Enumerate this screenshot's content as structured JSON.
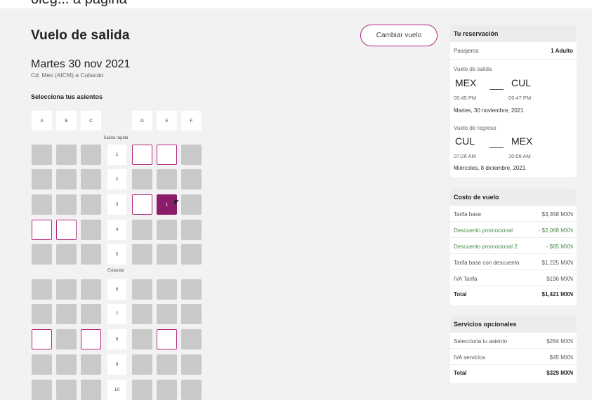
{
  "header": {
    "partial_text": "oleg... a pagina",
    "title": "Vuelo de salida",
    "change_label": "Cambiar vuelo",
    "date": "Martes 30 nov 2021",
    "route": "Cd. Mex (AICM) a Culiacán",
    "seat_prompt": "Selecciona tus asientos"
  },
  "seatmap": {
    "columns": [
      "A",
      "B",
      "C",
      "D",
      "E",
      "F"
    ],
    "section_fast": "Salida rápida",
    "section_standard": "Estándar",
    "selected_seat_label": "1",
    "rows": [
      {
        "num": "1",
        "seats": [
          "occupied",
          "occupied",
          "occupied",
          "available",
          "available",
          "occupied"
        ]
      },
      {
        "num": "2",
        "seats": [
          "occupied",
          "occupied",
          "occupied",
          "occupied",
          "occupied",
          "occupied"
        ]
      },
      {
        "num": "3",
        "seats": [
          "occupied",
          "occupied",
          "occupied",
          "available",
          "selected",
          "occupied"
        ]
      },
      {
        "num": "4",
        "seats": [
          "available",
          "available",
          "occupied",
          "occupied",
          "occupied",
          "occupied"
        ]
      },
      {
        "num": "5",
        "seats": [
          "occupied",
          "occupied",
          "occupied",
          "occupied",
          "occupied",
          "occupied"
        ]
      },
      {
        "num": "6",
        "seats": [
          "occupied",
          "occupied",
          "occupied",
          "occupied",
          "occupied",
          "occupied"
        ]
      },
      {
        "num": "7",
        "seats": [
          "occupied",
          "occupied",
          "occupied",
          "occupied",
          "occupied",
          "occupied"
        ]
      },
      {
        "num": "8",
        "seats": [
          "available",
          "occupied",
          "available",
          "occupied",
          "available",
          "occupied"
        ]
      },
      {
        "num": "9",
        "seats": [
          "occupied",
          "occupied",
          "occupied",
          "occupied",
          "occupied",
          "occupied"
        ]
      },
      {
        "num": "10",
        "seats": [
          "occupied",
          "occupied",
          "occupied",
          "occupied",
          "occupied",
          "occupied"
        ]
      }
    ]
  },
  "reservation": {
    "title": "Tu reservación",
    "passengers_label": "Pasajeros",
    "passengers_value": "1 Adulto",
    "outbound_label": "Vuelo de salida",
    "outbound_from": "MEX",
    "outbound_to": "CUL",
    "outbound_dep": "05:45 PM",
    "outbound_arr": "06:47 PM",
    "outbound_date": "Martes, 30 noviembre, 2021",
    "return_label": "Vuelo de regreso",
    "return_from": "CUL",
    "return_to": "MEX",
    "return_dep": "07:28 AM",
    "return_arr": "10:08 AM",
    "return_date": "Miércoles, 8 diciembre, 2021"
  },
  "cost": {
    "title": "Costo de vuelo",
    "rows": [
      {
        "label": "Tarifa base",
        "value": "$3,358 MXN"
      },
      {
        "label": "Descuento promocional",
        "value": "- $2,068 MXN"
      },
      {
        "label": "Descuento promocional 2",
        "value": "- $65 MXN"
      },
      {
        "label": "Tarifa base con descuento",
        "value": "$1,225 MXN"
      },
      {
        "label": "IVA Tarifa",
        "value": "$196 MXN"
      },
      {
        "label": "Total",
        "value": "$1,421 MXN"
      }
    ]
  },
  "services": {
    "title": "Servicios opcionales",
    "rows": [
      {
        "label": "Selecciona tu asiento",
        "value": "$284 MXN"
      },
      {
        "label": "IVA servicios",
        "value": "$45 MXN"
      },
      {
        "label": "Total",
        "value": "$329 MXN"
      }
    ]
  },
  "colors": {
    "accent": "#b3277f",
    "selected": "#8c1b6b",
    "promo": "#4a8c4a",
    "occupied": "#c9c9c9"
  },
  "icons": {
    "cursor": "mouse-pointer-icon"
  }
}
